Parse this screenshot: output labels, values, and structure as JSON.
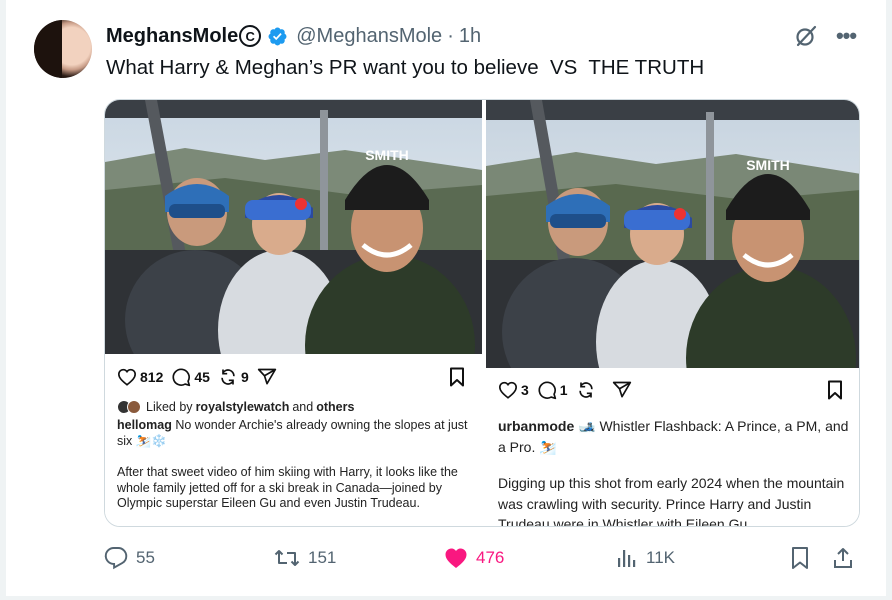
{
  "author": {
    "display_name": "MeghansMole",
    "copyright_symbol": "C",
    "handle": "@MeghansMole",
    "separator": "·",
    "timestamp": "1h"
  },
  "tweet": {
    "text": "What Harry & Meghan’s PR want you to believe  VS  THE TRUTH"
  },
  "media": {
    "left_panel": {
      "helmet_logo": "SMITH",
      "likes": "812",
      "comments": "45",
      "reposts": "9",
      "liked_by_prefix": "Liked by",
      "liked_by_user": "royalstylewatch",
      "liked_by_and": "and",
      "liked_by_others": "others",
      "caption_user": "hellomag",
      "caption_line1": "No wonder Archie's already owning the slopes at just six ⛷️❄️",
      "caption_para2": "After that sweet video of him skiing with Harry, it looks like the whole family jetted off for a ski break in Canada—joined by Olympic superstar Eileen Gu and even Justin Trudeau."
    },
    "right_panel": {
      "helmet_logo": "SMITH",
      "likes": "3",
      "comments": "1",
      "caption_user": "urbanmode",
      "caption_line1": "🎿 Whistler Flashback: A Prince, a PM, and a Pro. ⛷️",
      "caption_para2": "Digging up this shot from early 2024 when the mountain was crawling with security. Prince Harry and Justin Trudeau were in Whistler with Eileen Gu"
    }
  },
  "actions": {
    "replies": "55",
    "reposts": "151",
    "likes": "476",
    "views": "11K"
  },
  "colors": {
    "like_pink": "#f91880",
    "verified_blue": "#1d9bf0",
    "muted_gray": "#536471"
  },
  "icons": {
    "verified": "verified-badge-icon",
    "grok": "grok-icon",
    "more": "more-icon",
    "reply": "reply-icon",
    "retweet": "retweet-icon",
    "like": "heart-icon",
    "views": "views-icon",
    "bookmark": "bookmark-icon",
    "share": "share-icon"
  }
}
